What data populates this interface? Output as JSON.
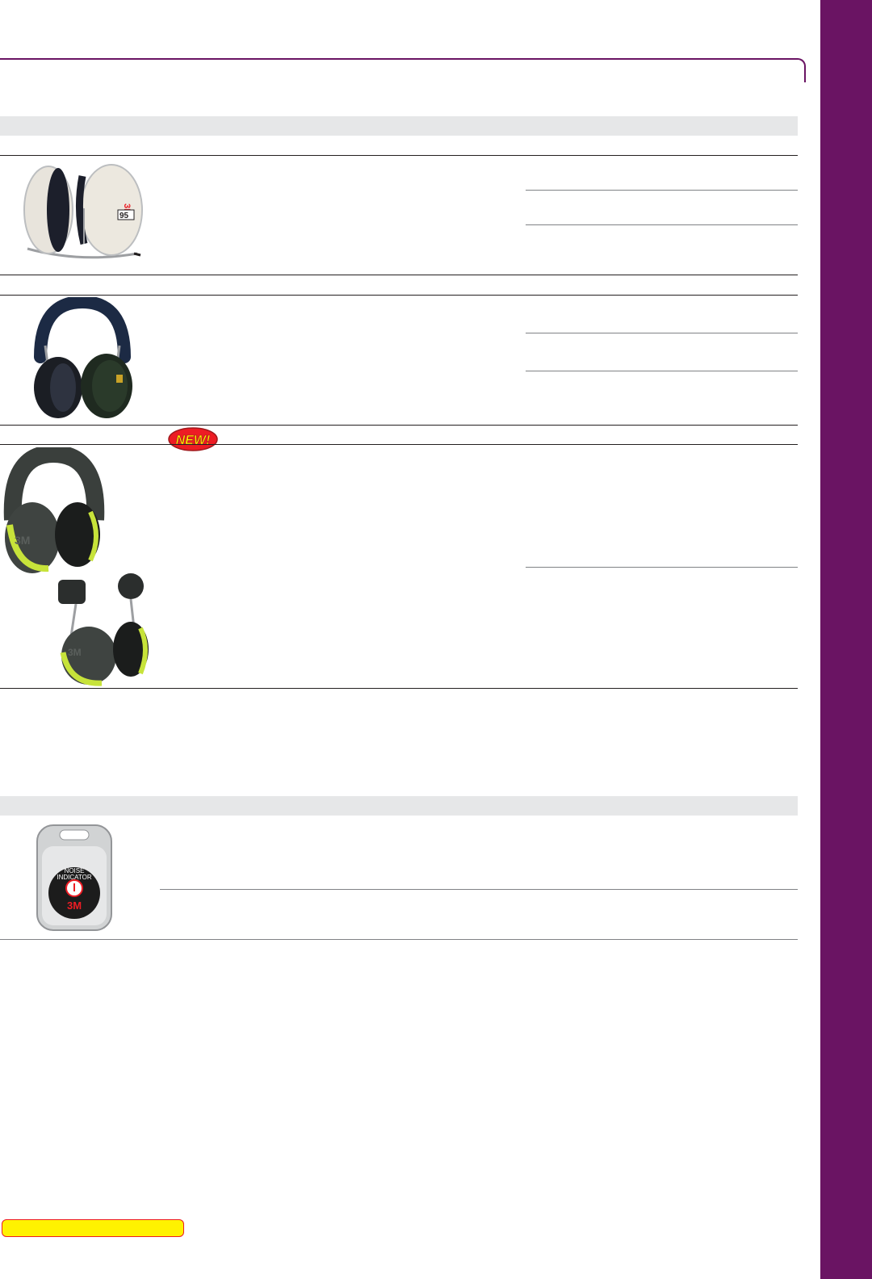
{
  "badges": {
    "new_label": "NEW!"
  },
  "images": {
    "noise_indicator_text_1": "NOISE",
    "noise_indicator_text_2": "INDICATOR",
    "brand_mark": "3M",
    "rating_mark": "95"
  },
  "colors": {
    "sidebar": "#6a1463",
    "band": "#e6e7e8",
    "rule": "#231f20",
    "badge_fill": "#ed1c24",
    "badge_text": "#fff200",
    "promo_fill": "#fff200",
    "promo_border": "#ed1c24",
    "earmuff_green": "#c7e33a"
  }
}
